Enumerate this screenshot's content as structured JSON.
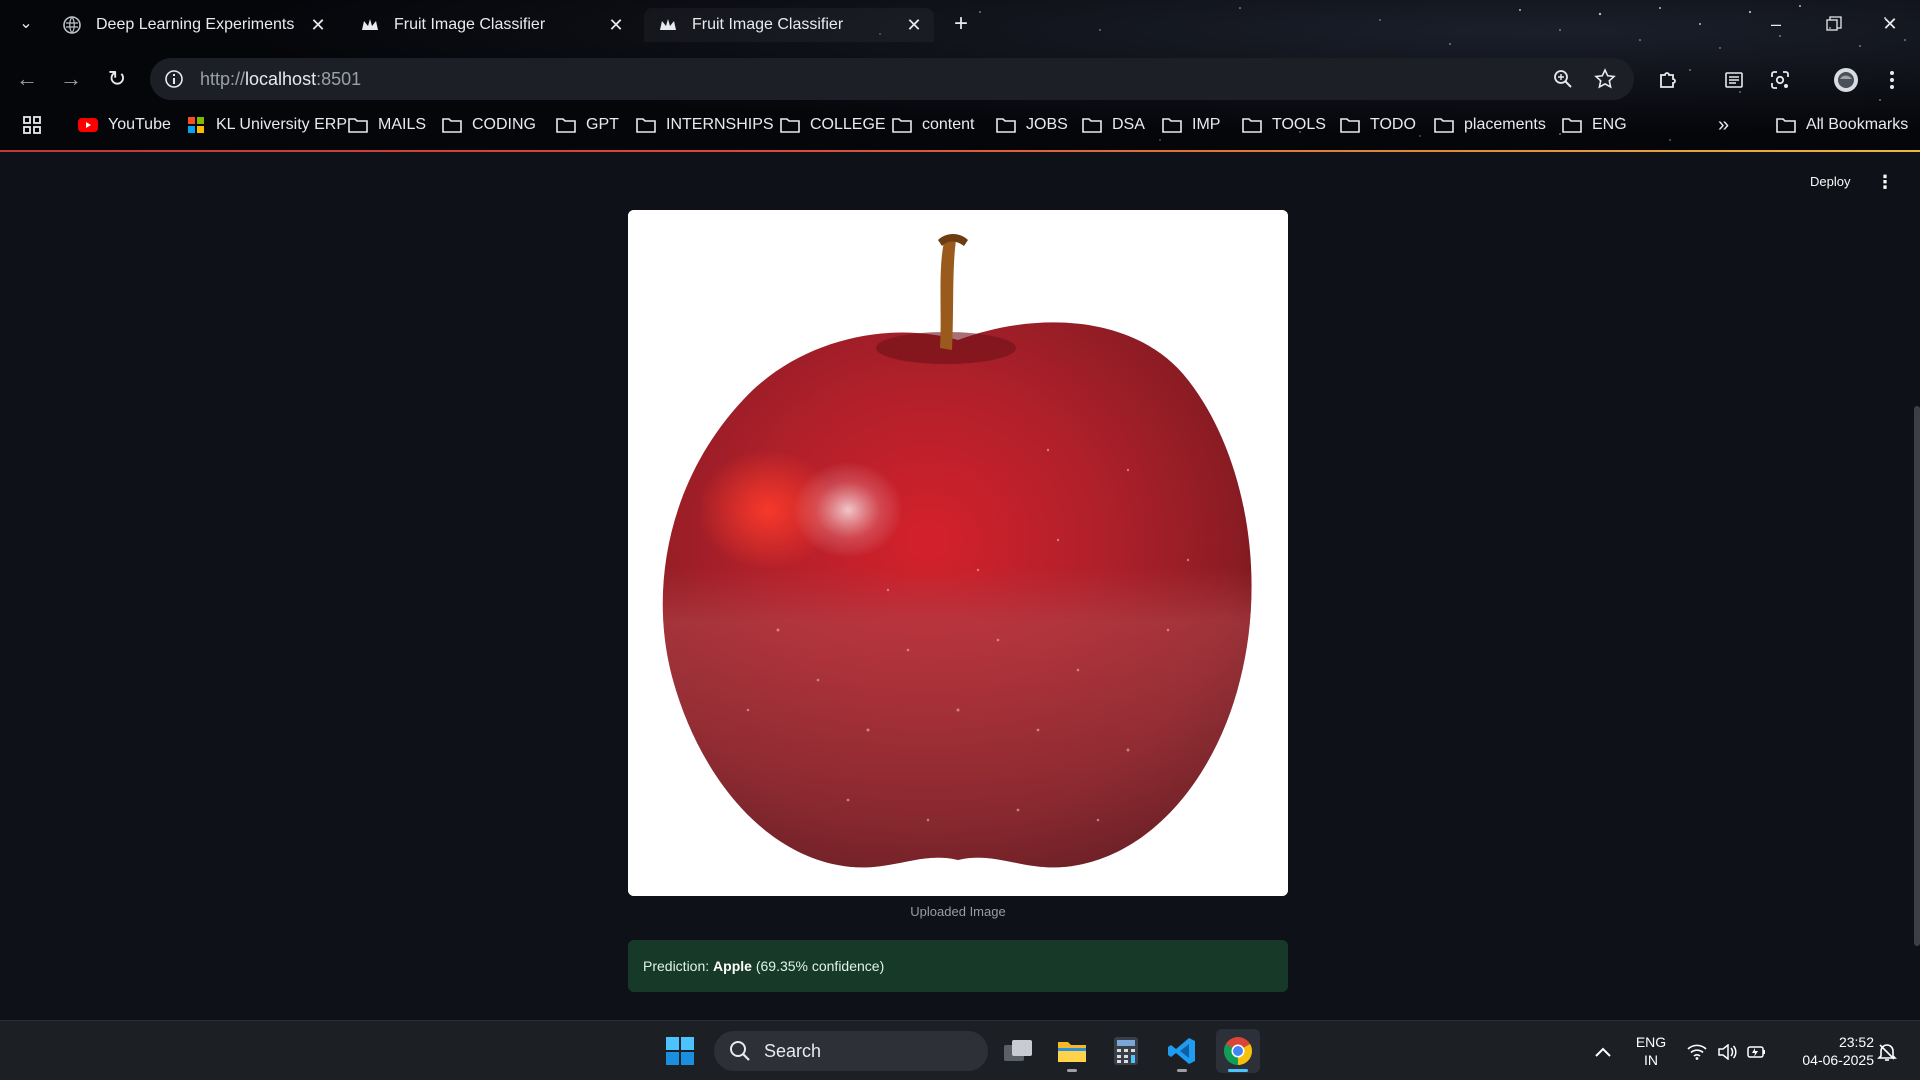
{
  "browser": {
    "tabs": [
      {
        "title": "Deep Learning Experiments",
        "favicon": "globe-icon"
      },
      {
        "title": "Fruit Image Classifier",
        "favicon": "streamlit-crown-icon"
      },
      {
        "title": "Fruit Image Classifier",
        "favicon": "streamlit-crown-icon"
      }
    ],
    "url_prefix": "http://",
    "url_host": "localhost",
    "url_port": ":8501",
    "bookmarks": [
      {
        "label": "YouTube",
        "icon": "youtube-icon"
      },
      {
        "label": "KL University ERP",
        "icon": "erp-icon"
      },
      {
        "label": "MAILS",
        "icon": "folder-icon"
      },
      {
        "label": "CODING",
        "icon": "folder-icon"
      },
      {
        "label": "GPT",
        "icon": "folder-icon"
      },
      {
        "label": "INTERNSHIPS",
        "icon": "folder-icon"
      },
      {
        "label": "COLLEGE",
        "icon": "folder-icon"
      },
      {
        "label": "content",
        "icon": "folder-icon"
      },
      {
        "label": "JOBS",
        "icon": "folder-icon"
      },
      {
        "label": "DSA",
        "icon": "folder-icon"
      },
      {
        "label": "IMP",
        "icon": "folder-icon"
      },
      {
        "label": "TOOLS",
        "icon": "folder-icon"
      },
      {
        "label": "TODO",
        "icon": "folder-icon"
      },
      {
        "label": "placements",
        "icon": "folder-icon"
      },
      {
        "label": "ENG",
        "icon": "folder-icon"
      }
    ],
    "all_bookmarks": "All Bookmarks"
  },
  "app": {
    "deploy_label": "Deploy",
    "image_caption": "Uploaded Image",
    "prediction_label": "Prediction:",
    "prediction_class": "Apple",
    "prediction_confidence": "(69.35% confidence)",
    "success_color": "#173928"
  },
  "taskbar": {
    "search_placeholder": "Search",
    "lang_top": "ENG",
    "lang_bottom": "IN",
    "time": "23:52",
    "date": "04-06-2025"
  }
}
